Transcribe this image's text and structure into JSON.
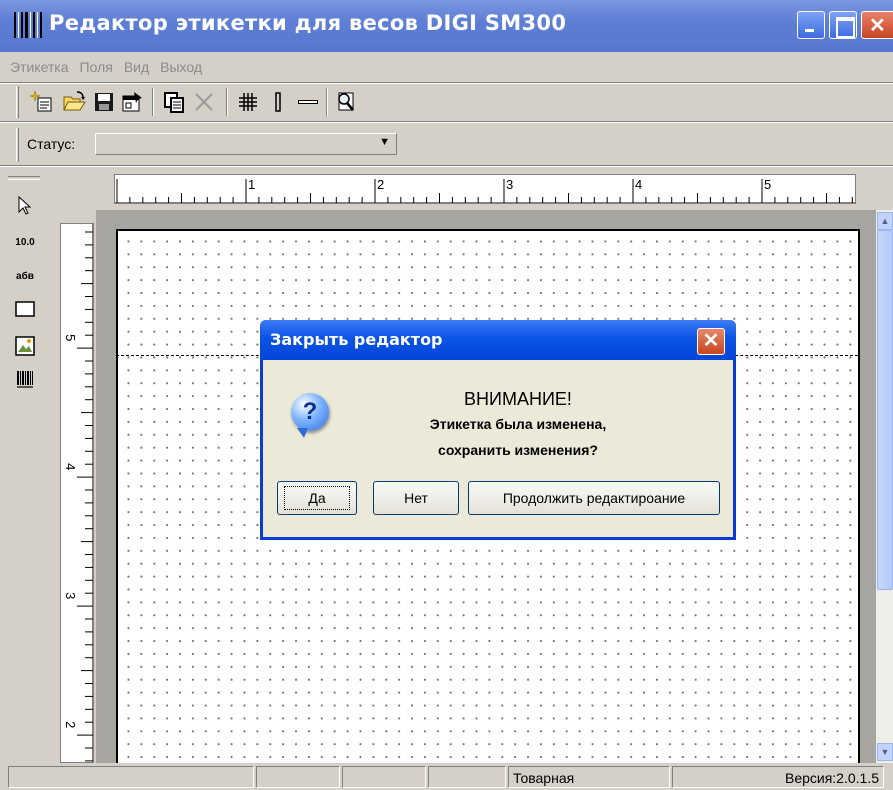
{
  "window": {
    "title": "Редактор этикетки для весов DIGI SM300"
  },
  "menu": {
    "items": [
      "Этикетка",
      "Поля",
      "Вид",
      "Выход"
    ]
  },
  "toolbar": {
    "tools": [
      "new-icon",
      "open-icon",
      "save-icon",
      "properties-icon",
      "copy-icon",
      "delete-icon",
      "grid-icon",
      "vertical-line-icon",
      "horizontal-line-icon",
      "preview-icon"
    ]
  },
  "status": {
    "label": "Статус:",
    "value": ""
  },
  "palette": {
    "number_label": "10.0",
    "text_label": "абв"
  },
  "rulers": {
    "horizontal": [
      "1",
      "2",
      "3",
      "4",
      "5"
    ],
    "vertical": [
      "5",
      "4",
      "3",
      "2"
    ]
  },
  "statusbar": {
    "mode": "Товарная",
    "version": "Версия:2.0.1.5"
  },
  "dialog": {
    "title": "Закрыть редактор",
    "heading": "ВНИМАНИЕ!",
    "line1": "Этикетка была изменена,",
    "line2": "сохранить изменения?",
    "yes": "Да",
    "no": "Нет",
    "continue": "Продолжить редактироание"
  }
}
